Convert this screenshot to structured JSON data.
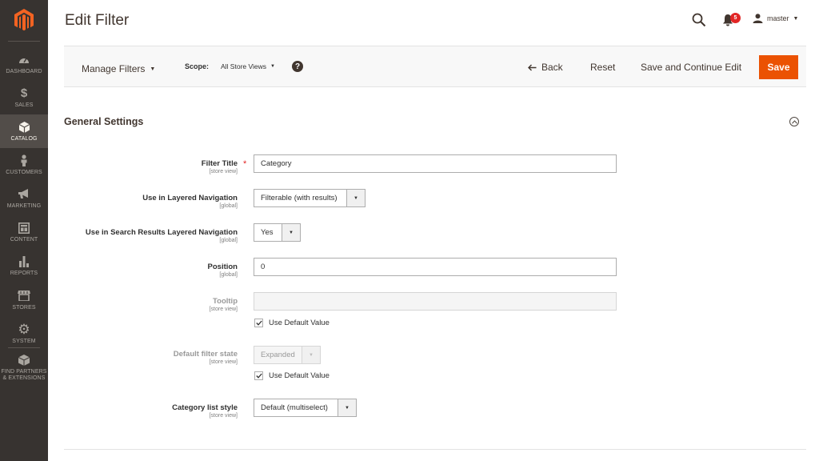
{
  "sidebar": {
    "items": [
      {
        "label": "DASHBOARD",
        "icon": "dashboard-icon"
      },
      {
        "label": "SALES",
        "icon": "dollar-icon"
      },
      {
        "label": "CATALOG",
        "icon": "cube-icon",
        "active": true
      },
      {
        "label": "CUSTOMERS",
        "icon": "person-icon"
      },
      {
        "label": "MARKETING",
        "icon": "megaphone-icon"
      },
      {
        "label": "CONTENT",
        "icon": "layout-icon"
      },
      {
        "label": "REPORTS",
        "icon": "bar-chart-icon"
      },
      {
        "label": "STORES",
        "icon": "store-icon"
      },
      {
        "label": "SYSTEM",
        "icon": "gear-icon"
      },
      {
        "label_1": "FIND PARTNERS",
        "label_2": "& EXTENSIONS",
        "icon": "box-icon"
      }
    ]
  },
  "header": {
    "title": "Edit Filter",
    "notification_count": "5",
    "username": "master"
  },
  "toolbar": {
    "manage_filters": "Manage Filters",
    "scope_label": "Scope:",
    "scope_value": "All Store Views",
    "help": "?",
    "back": "Back",
    "reset": "Reset",
    "save_continue": "Save and Continue Edit",
    "save": "Save"
  },
  "section": {
    "title": "General Settings"
  },
  "fields": {
    "filter_title": {
      "label": "Filter Title",
      "scope": "[store view]",
      "value": "Category",
      "required": "*"
    },
    "layered_nav": {
      "label": "Use in Layered Navigation",
      "scope": "[global]",
      "value": "Filterable (with results)"
    },
    "search_layered_nav": {
      "label": "Use in Search Results Layered Navigation",
      "scope": "[global]",
      "value": "Yes"
    },
    "position": {
      "label": "Position",
      "scope": "[global]",
      "value": "0"
    },
    "tooltip": {
      "label": "Tooltip",
      "scope": "[store view]",
      "value": "",
      "use_default": "Use Default Value"
    },
    "default_state": {
      "label": "Default filter state",
      "scope": "[store view]",
      "value": "Expanded",
      "use_default": "Use Default Value"
    },
    "category_list_style": {
      "label": "Category list style",
      "scope": "[store view]",
      "value": "Default (multiselect)"
    }
  },
  "colors": {
    "sidebar_bg": "#373330",
    "accent": "#eb5202",
    "badge": "#e22626"
  }
}
